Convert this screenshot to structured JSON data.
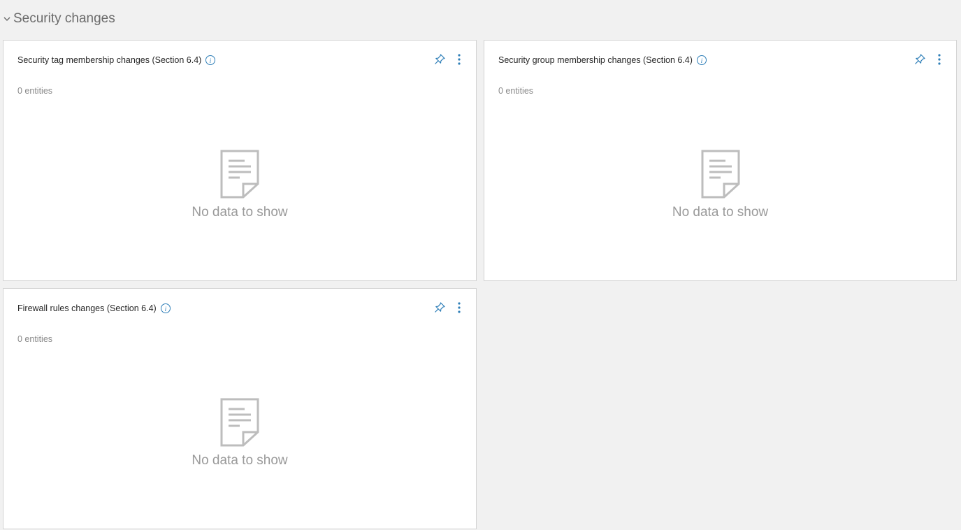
{
  "section": {
    "title": "Security changes",
    "chevron_icon": "chevron-down-icon"
  },
  "cards": [
    {
      "title": "Security tag membership changes (Section 6.4)",
      "entities": "0 entities",
      "empty_text": "No data to show"
    },
    {
      "title": "Security group membership changes (Section 6.4)",
      "entities": "0 entities",
      "empty_text": "No data to show"
    },
    {
      "title": "Firewall rules changes (Section 6.4)",
      "entities": "0 entities",
      "empty_text": "No data to show"
    }
  ],
  "icons": {
    "info": "info-icon",
    "pin": "pin-icon",
    "menu": "more-vertical-icon",
    "empty": "document-icon"
  },
  "colors": {
    "background": "#f1f1f1",
    "card_border": "#d3d3d3",
    "accent": "#2f7fb8",
    "empty_icon": "#bdbdbd",
    "muted_text": "#9a9a9a"
  }
}
